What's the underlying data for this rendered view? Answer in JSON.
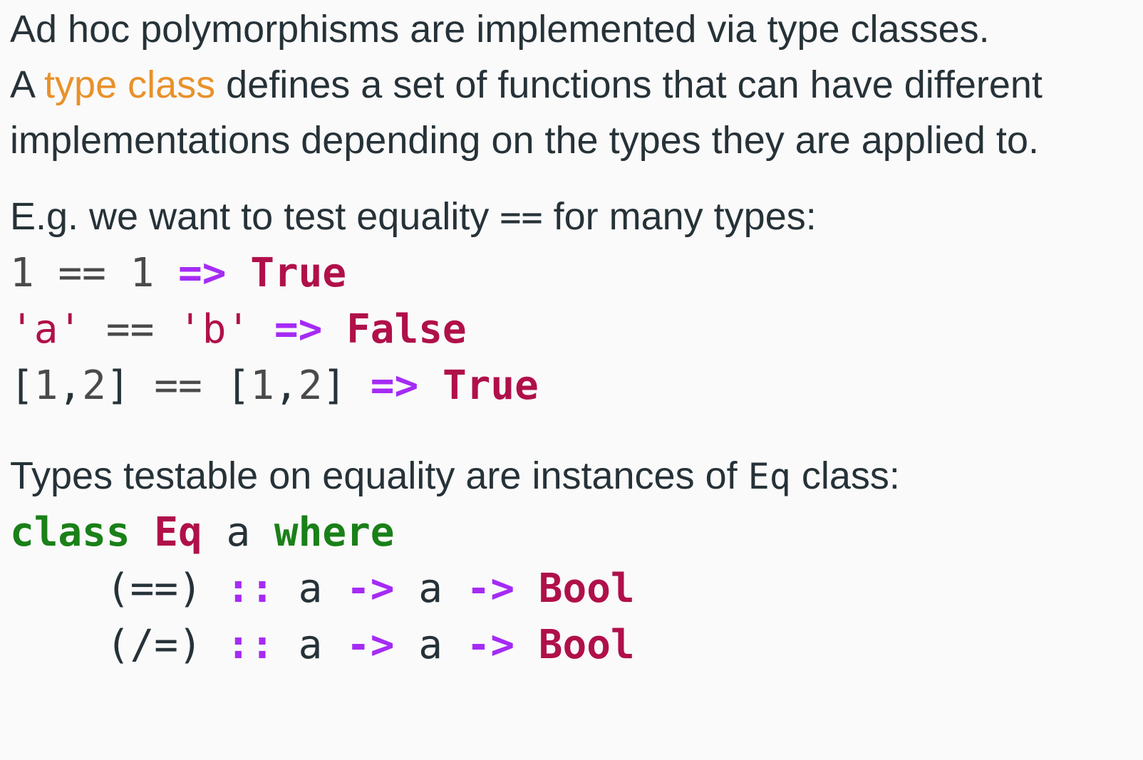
{
  "intro": {
    "line1": "Ad hoc polymorphisms are implemented via type classes.",
    "line2_prefix": "A ",
    "line2_term": "type class",
    "line2_suffix": " defines a set of functions that can have different",
    "line3": "implementations depending on the types they are applied to."
  },
  "example_intro": {
    "prefix": "E.g. we want to test equality ",
    "operator": "==",
    "suffix": " for many types:"
  },
  "equality_examples": [
    {
      "lhs": "1",
      "op": "==",
      "rhs": "1",
      "arrow": "=>",
      "result": "True"
    },
    {
      "lhs": "'a'",
      "op": "==",
      "rhs": "'b'",
      "arrow": "=>",
      "result": "False"
    },
    {
      "lhs_open": "[",
      "lhs_a": "1",
      "lhs_sep": ",",
      "lhs_b": "2",
      "lhs_close": "]",
      "op": "==",
      "rhs_open": "[",
      "rhs_a": "1",
      "rhs_sep": ",",
      "rhs_b": "2",
      "rhs_close": "]",
      "arrow": "=>",
      "result": "True"
    }
  ],
  "eq_intro": {
    "prefix": "Types testable on equality are instances of ",
    "class_name": "Eq",
    "suffix": " class:"
  },
  "class_def": {
    "keyword": "class",
    "name": "Eq",
    "type_var": "a",
    "where": "where",
    "methods": [
      {
        "name": "(==)",
        "sig_op": "::",
        "arg1": "a",
        "arrow1": "->",
        "arg2": "a",
        "arrow2": "->",
        "ret": "Bool"
      },
      {
        "name": "(/=)",
        "sig_op": "::",
        "arg1": "a",
        "arrow1": "->",
        "arg2": "a",
        "arrow2": "->",
        "ret": "Bool"
      }
    ]
  },
  "colors": {
    "text": "#263238",
    "highlight": "#e8912a",
    "arrow": "#a52bf5",
    "constructor": "#b0104a",
    "keyword": "#1a8018",
    "background": "#fafafa"
  }
}
